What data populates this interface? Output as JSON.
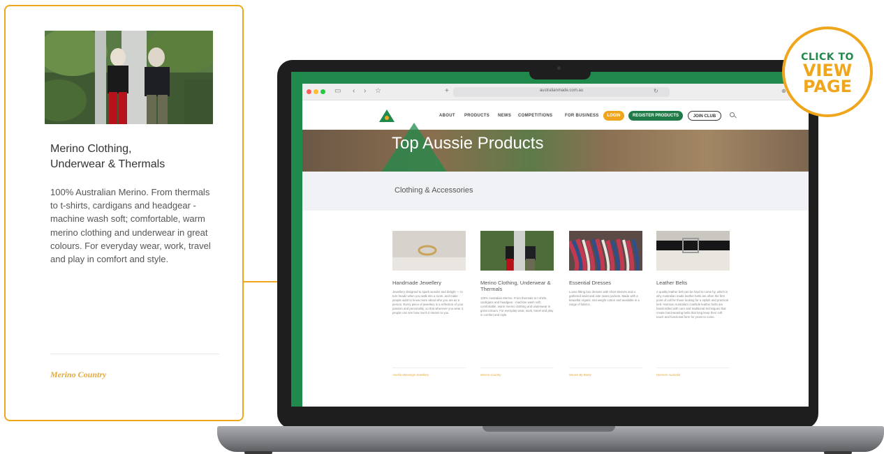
{
  "callout": {
    "title_line1": "Merino Clothing,",
    "title_line2": "Underwear & Thermals",
    "description": "100% Australian Merino. From thermals to t-shirts, cardigans and headgear - machine wash soft; comfortable, warm merino clothing and underwear in great colours. For everyday wear, work, travel and play in comfort and style.",
    "brand": "Merino Country"
  },
  "badge": {
    "line1": "CLICK TO",
    "line2": "VIEW",
    "line3": "PAGE"
  },
  "browser": {
    "url": "australianmade.com.au",
    "nav": {
      "about": "ABOUT",
      "products": "PRODUCTS",
      "news": "NEWS",
      "competitions": "COMPETITIONS",
      "for_business": "FOR BUSINESS",
      "login": "LOGIN",
      "register": "REGISTER PRODUCTS",
      "join": "JOIN CLUB"
    },
    "hero_title": "Top Aussie Products",
    "section_title": "Clothing & Accessories",
    "cards": [
      {
        "title": "Handmade Jewellery",
        "desc": "Jewellery designed to spark wonder and delight — to turn heads when you walk into a room, and make people want to know more about who you are as a person. Every piece of jewellery is a reflection of your passion and personality, so that wherever you wear it, people can see how much it means to you.",
        "brand": "Amelia Meanings Jewellery"
      },
      {
        "title": "Merino Clothing, Underwear & Thermals",
        "desc": "100% Australian Merino. From thermals to t-shirts, cardigans and headgear - machine wash soft; comfortable, warm merino clothing and underwear in great colours. For everyday wear, work, travel and play in comfort and style.",
        "brand": "Merino Country"
      },
      {
        "title": "Essential Dresses",
        "desc": "Loose fitting box dresses with short sleeves and a gathered waist and side seam pockets. Made with a beautiful organic mid weight cotton and available in a range of fabrics.",
        "brand": "Woven By Bonty"
      },
      {
        "title": "Leather Belts",
        "desc": "A quality leather belt can be hard to come by, which is why Australian made leather belts are often the first point of call for those looking for a stylish and practical belt. Harrison Australia's cowhide leather belts are handcrafted with care and traditional techniques that create hard-wearing belts that long keep their soft touch and functional form for years to come.",
        "brand": "Harrison Australia"
      }
    ]
  }
}
